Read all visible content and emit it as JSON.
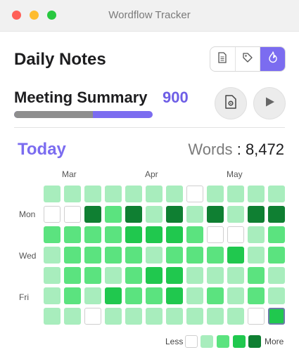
{
  "window": {
    "title": "Wordflow Tracker"
  },
  "header": {
    "title": "Daily Notes",
    "tabs": [
      "document-icon",
      "tag-icon",
      "flame-icon"
    ],
    "active_tab": 2
  },
  "note": {
    "title": "Meeting Summary",
    "word_count": "900",
    "progress": 0.57
  },
  "actions": [
    "doc-settings-icon",
    "play-icon"
  ],
  "stats": {
    "period": "Today",
    "words_label": "Words",
    "separator": ":",
    "words_value": "8,472"
  },
  "heatmap": {
    "months": [
      "Mar",
      "Apr",
      "May"
    ],
    "days": [
      "Mon",
      "Wed",
      "Fri"
    ],
    "legend": {
      "less": "Less",
      "more": "More"
    },
    "colors": [
      "#ffffff",
      "#a8edbd",
      "#5be37f",
      "#20c84e",
      "#0f7f32"
    ],
    "cells": [
      [
        1,
        1,
        1,
        1,
        1,
        1,
        1,
        0,
        1,
        1,
        1,
        1
      ],
      [
        0,
        0,
        4,
        2,
        4,
        1,
        4,
        1,
        4,
        1,
        4,
        4
      ],
      [
        2,
        2,
        2,
        2,
        3,
        3,
        3,
        2,
        0,
        0,
        1,
        2
      ],
      [
        1,
        2,
        2,
        2,
        2,
        1,
        2,
        2,
        2,
        3,
        1,
        2
      ],
      [
        1,
        2,
        2,
        1,
        2,
        3,
        3,
        1,
        1,
        1,
        2,
        1
      ],
      [
        1,
        2,
        1,
        3,
        2,
        2,
        3,
        1,
        2,
        1,
        2,
        1
      ],
      [
        1,
        1,
        0,
        1,
        1,
        1,
        1,
        1,
        1,
        1,
        0,
        3
      ]
    ],
    "selected": [
      6,
      11
    ]
  }
}
